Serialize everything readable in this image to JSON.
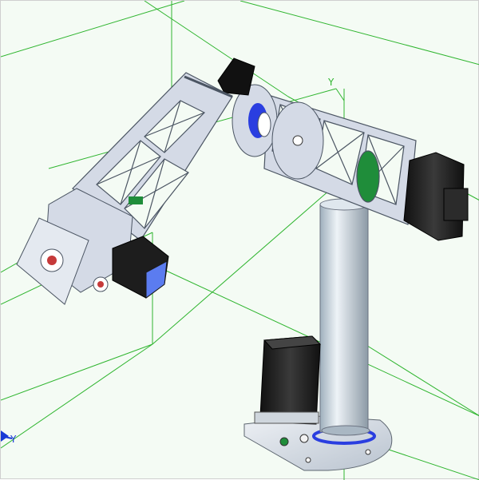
{
  "viewport": {
    "background": "#f4fbf4",
    "grid_color": "#2fb52f",
    "axis_label_y_upper": "Y",
    "axis_label_y_lower": "Y",
    "triad_color": "#1a3ad6"
  },
  "colors": {
    "frame_metal": "#d4dae6",
    "frame_edge": "#6b7280",
    "motor_body": "#222222",
    "motor_face": "#5b7cf0",
    "column": "#cbd6de",
    "ring_blue": "#2a3ee0",
    "ring_green": "#1f8d3a",
    "base_plate": "#e8ecf0"
  }
}
